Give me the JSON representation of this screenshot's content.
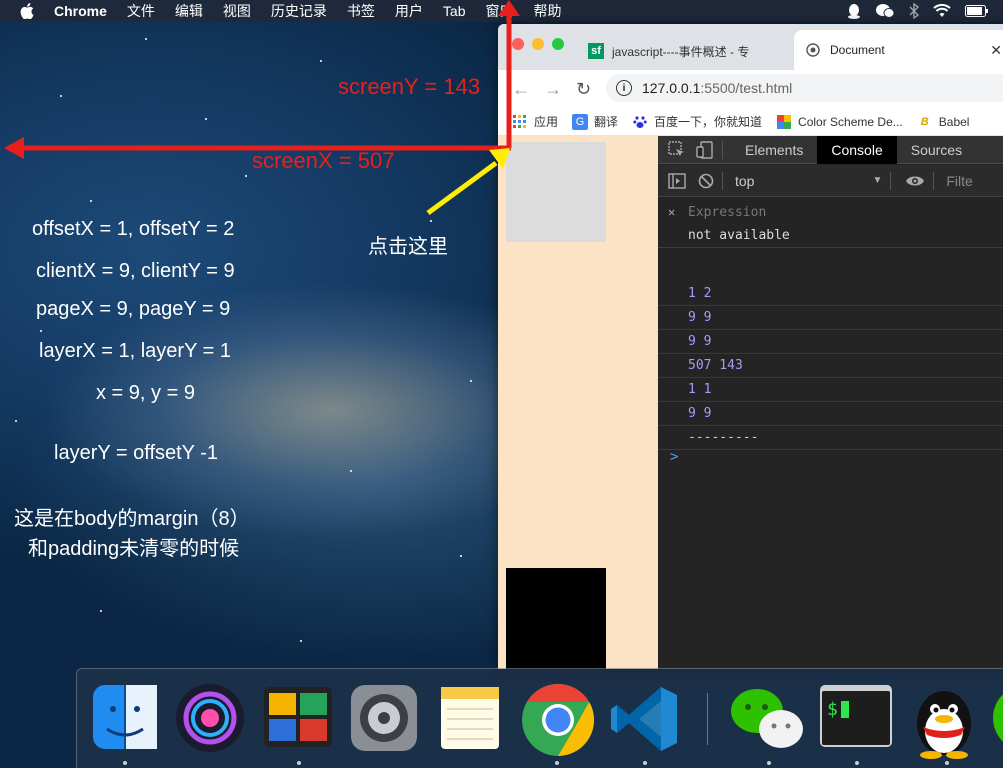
{
  "menubar": {
    "items": [
      "Chrome",
      "文件",
      "编辑",
      "视图",
      "历史记录",
      "书签",
      "用户",
      "Tab",
      "窗口",
      "帮助"
    ]
  },
  "annotations": {
    "screen_y": "screenY = 143",
    "screen_x": "screenX = 507",
    "click_here": "点击这里",
    "lines": [
      "offsetX = 1, offsetY = 2",
      "clientX = 9, clientY = 9",
      "pageX = 9, pageY = 9",
      "layerX = 1, layerY = 1",
      "x = 9, y = 9",
      "layerY = offsetY -1",
      "这是在body的margin（8）",
      "和padding未清零的时候"
    ]
  },
  "browser": {
    "tabs": [
      {
        "label": "javascript----事件概述 - 专",
        "favicon": "sf"
      },
      {
        "label": "Document"
      }
    ],
    "url": {
      "host": "127.0.0.1",
      "rest": ":5500/test.html"
    },
    "bookmarks": [
      "应用",
      "翻译",
      "百度一下，你就知道",
      "Color Scheme De...",
      "Babel"
    ]
  },
  "devtools": {
    "tabs": [
      "Elements",
      "Console",
      "Sources"
    ],
    "active_tab": "Console",
    "context": "top",
    "filter_placeholder": "Filte",
    "expression_label": "Expression",
    "expression_value": "not available",
    "logs": [
      "1 2",
      "9 9",
      "9 9",
      "507 143",
      "1 1",
      "9 9",
      "---------"
    ],
    "prompt": ">"
  },
  "colors": {
    "arrow_red": "#e8201c",
    "arrow_yellow": "#ffee00",
    "console_log": "#a59cf4",
    "page_bg": "#fde3c6"
  },
  "dock": {
    "icons": [
      "finder-icon",
      "siri-icon",
      "photo-booth-icon",
      "system-preferences-icon",
      "notes-icon",
      "chrome-icon",
      "vscode-icon",
      "wechat-icon",
      "terminal-icon",
      "qq-icon",
      "wechat-partial-icon"
    ]
  }
}
